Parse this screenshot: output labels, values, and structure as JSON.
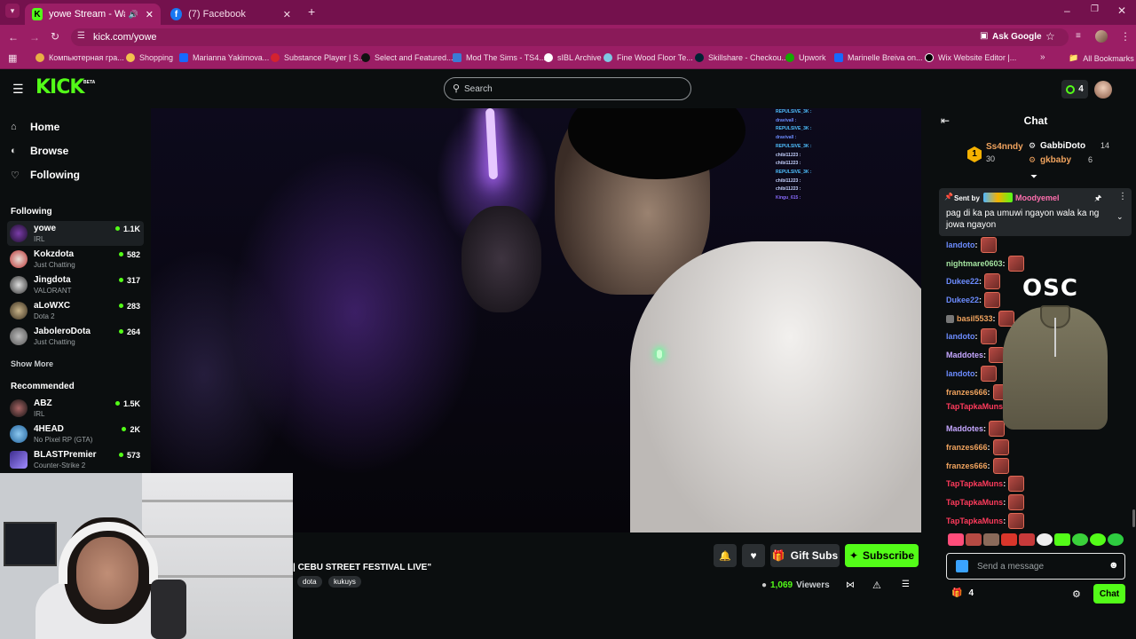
{
  "browser": {
    "tabs": [
      {
        "title": "yowe Stream - Watch Live o",
        "favicon": "kick-favicon",
        "active": true
      },
      {
        "title": "(7) Facebook",
        "favicon": "facebook-favicon",
        "active": false
      }
    ],
    "url": "kick.com/yowe",
    "ask_google": "Ask Google",
    "bookmarks": [
      "Компьютерная гра...",
      "Shopping",
      "Marianna Yakimova...",
      "Substance Player | S...",
      "Select and Featured...",
      "Mod The Sims - TS4...",
      "sIBL Archive",
      "Fine Wood Floor Te...",
      "Skillshare - Checkou...",
      "Upwork",
      "Marinelle Breiva on...",
      "Wix Website Editor |..."
    ],
    "all_bookmarks": "All Bookmarks"
  },
  "kick": {
    "logo": "KICK",
    "beta": "BETA",
    "search_placeholder": "Search",
    "notif_count": "4"
  },
  "sidebar": {
    "nav": [
      {
        "label": "Home",
        "icon": "home-icon"
      },
      {
        "label": "Browse",
        "icon": "compass-icon"
      },
      {
        "label": "Following",
        "icon": "heart-icon"
      }
    ],
    "following_title": "Following",
    "following": [
      {
        "name": "yowe",
        "category": "IRL",
        "viewers": "1.1K"
      },
      {
        "name": "Kokzdota",
        "category": "Just Chatting",
        "viewers": "582"
      },
      {
        "name": "Jingdota",
        "category": "VALORANT",
        "viewers": "317"
      },
      {
        "name": "aLoWXC",
        "category": "Dota 2",
        "viewers": "283"
      },
      {
        "name": "JaboleroDota",
        "category": "Just Chatting",
        "viewers": "264"
      }
    ],
    "show_more": "Show More",
    "recommended_title": "Recommended",
    "recommended": [
      {
        "name": "ABZ",
        "category": "IRL",
        "viewers": "1.5K"
      },
      {
        "name": "4HEAD",
        "category": "No Pixel RP (GTA)",
        "viewers": "2K"
      },
      {
        "name": "BLASTPremier",
        "category": "Counter-Strike 2",
        "viewers": "573"
      }
    ]
  },
  "video_overlay": {
    "lines": [
      "REPULSIVE_3K :",
      "dravivall :",
      "REPULSIVE_3K :",
      "dravivall :",
      "REPULSIVE_3K :",
      "chibi11223 :",
      "chibi11223 :",
      "REPULSIVE_3K :",
      "chibi11223 :",
      "chibi11223 :",
      "Kingu_615 :"
    ]
  },
  "stream": {
    "title": "| CEBU STREET FESTIVAL LIVE\"",
    "tags": [
      "dota",
      "kukuys"
    ],
    "gift_subs": "Gift Subs",
    "subscribe": "Subscribe",
    "viewers": "1,069",
    "viewers_label": "Viewers"
  },
  "chat": {
    "title": "Chat",
    "leaderboard": [
      {
        "rank": "1",
        "name": "Ss4nndy",
        "count": "30"
      },
      {
        "name": "GabbiDoto",
        "count": "14"
      },
      {
        "name": "gkbaby",
        "count": "6"
      }
    ],
    "pinned": {
      "sent_by": "Sent by",
      "author": "Moodyemel",
      "text": "pag di ka pa umuwi ngayon wala ka ng jowa ngayon"
    },
    "messages": [
      {
        "user": "landoto",
        "color": "#6c8cff"
      },
      {
        "user": "nightmare0603",
        "color": "#a4e3a0"
      },
      {
        "user": "Dukee22",
        "color": "#6c8cff"
      },
      {
        "user": "Dukee22",
        "color": "#6c8cff"
      },
      {
        "user": "basil5533",
        "color": "#f0a35e"
      },
      {
        "user": "landoto",
        "color": "#6c8cff"
      },
      {
        "user": "Maddotes",
        "color": "#c5a7ff"
      },
      {
        "user": "landoto",
        "color": "#6c8cff"
      },
      {
        "user": "franzes666",
        "color": "#f0a35e"
      },
      {
        "user": "TapTapkaMuns",
        "color": "#ff3b5c"
      },
      {
        "user": "Maddotes",
        "color": "#c5a7ff"
      },
      {
        "user": "franzes666",
        "color": "#f0a35e"
      },
      {
        "user": "franzes666",
        "color": "#f0a35e"
      },
      {
        "user": "TapTapkaMuns",
        "color": "#ff3b5c"
      },
      {
        "user": "TapTapkaMuns",
        "color": "#ff3b5c"
      },
      {
        "user": "TapTapkaMuns",
        "color": "#ff3b5c"
      }
    ],
    "ad_logo": "OSC",
    "input_placeholder": "Send a message",
    "points": "4",
    "send": "Chat"
  },
  "colors": {
    "accent": "#53fc18",
    "browser": "#9b1e65"
  }
}
